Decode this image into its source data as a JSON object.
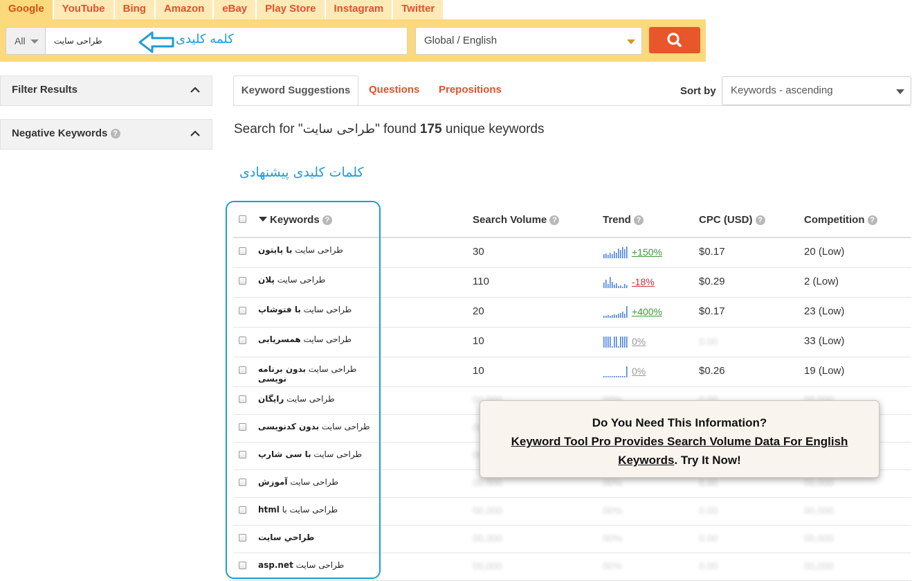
{
  "source_tabs": [
    "Google",
    "YouTube",
    "Bing",
    "Amazon",
    "eBay",
    "Play Store",
    "Instagram",
    "Twitter"
  ],
  "search": {
    "scope": "All",
    "value": "طراحی سایت",
    "annotation": "کلمه کلیدی",
    "location": "Global / English"
  },
  "filters": {
    "filter_results": "Filter Results",
    "negative_keywords": "Negative Keywords"
  },
  "tabs": {
    "suggestions": "Keyword Suggestions",
    "questions": "Questions",
    "prepositions": "Prepositions"
  },
  "sort": {
    "label": "Sort by",
    "value": "Keywords - ascending"
  },
  "summary": {
    "prefix": "Search for \"",
    "term": "طراحی سایت",
    "mid": "\" found ",
    "count": "175",
    "suffix": " unique keywords"
  },
  "suggest_annotation": "کلمات کلیدی پیشنهادی",
  "columns": {
    "keywords": "Keywords",
    "volume": "Search Volume",
    "trend": "Trend",
    "cpc": "CPC (USD)",
    "competition": "Competition"
  },
  "rows": [
    {
      "base": "طراحی سایت",
      "extra": "با پایتون",
      "volume": "30",
      "trend": "+150%",
      "cpc": "$0.17",
      "comp": "20 (Low)"
    },
    {
      "base": "طراحی سایت",
      "extra": "پلان",
      "volume": "110",
      "trend": "-18%",
      "cpc": "$0.29",
      "comp": "2 (Low)"
    },
    {
      "base": "طراحی سایت",
      "extra": "با فتوشاپ",
      "volume": "20",
      "trend": "+400%",
      "cpc": "$0.17",
      "comp": "23 (Low)"
    },
    {
      "base": "طراحی سایت",
      "extra": "همسریابی",
      "volume": "10",
      "trend": "0%",
      "cpc": "0.00",
      "comp": "33 (Low)"
    },
    {
      "base": "طراحی سایت",
      "extra": "بدون برنامه نویسی",
      "volume": "10",
      "trend": "0%",
      "cpc": "$0.26",
      "comp": "19 (Low)"
    },
    {
      "base": "طراحی سایت",
      "extra": "رایگان"
    },
    {
      "base": "طراحی سایت",
      "extra": "بدون کدنویسی"
    },
    {
      "base": "طراحی سایت",
      "extra": "با سی شارپ"
    },
    {
      "base": "طراحی سایت",
      "extra": "آموزش"
    },
    {
      "base": "طراحی سایت با",
      "extra": "html"
    },
    {
      "base": "",
      "extra": "طراحي سايت"
    },
    {
      "base": "طراحی سایت",
      "extra": "asp.net"
    }
  ],
  "blurred": {
    "volume": "00,000",
    "trend": "00%",
    "cpc": "0.00",
    "comp": "00,000"
  },
  "promo": {
    "question": "Do You Need This Information?",
    "link": "Keyword Tool Pro Provides Search Volume Data For English Keywords",
    "cta": ". Try It Now!"
  }
}
